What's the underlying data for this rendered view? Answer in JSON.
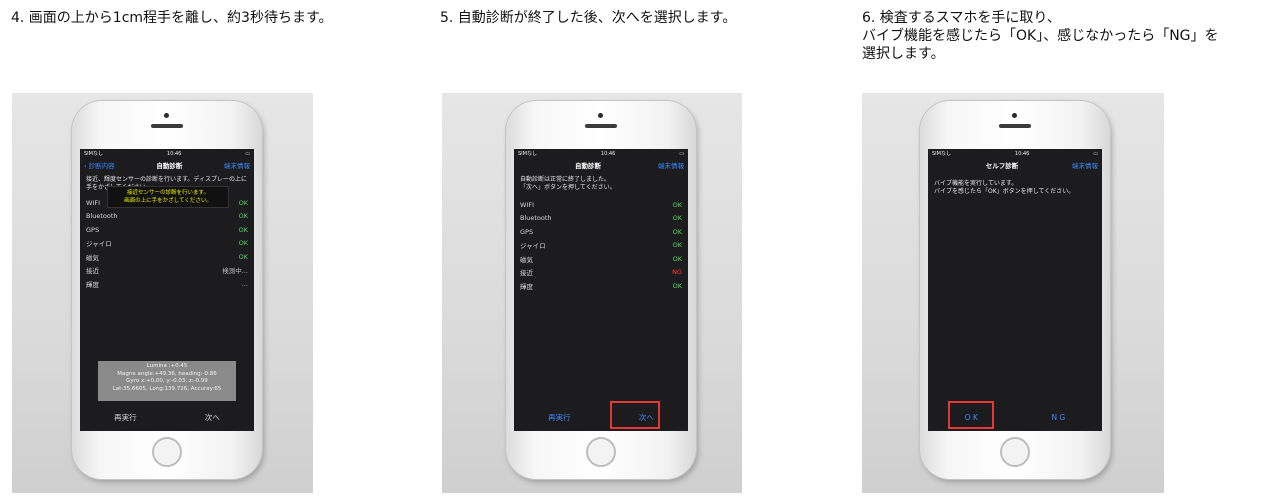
{
  "steps": [
    {
      "caption": "4. 画面の上から1cm程手を離し、約3秒待ちます。",
      "screen": {
        "status_left": "SIMなし",
        "status_time": "10:46",
        "nav_back": "診断内容",
        "nav_title": "自動診断",
        "nav_right": "端末情報",
        "message": "接近、輝度センサーの診断を行います。ディスプレーの上に手をかざしてください。",
        "toast": [
          "接近センサーの診断を行います。",
          "画面の上に手をかざしてください。"
        ],
        "rows": [
          {
            "label": "WIFI",
            "status": "OK"
          },
          {
            "label": "Bluetooth",
            "status": "OK"
          },
          {
            "label": "GPS",
            "status": "OK"
          },
          {
            "label": "ジャイロ",
            "status": "OK"
          },
          {
            "label": "磁気",
            "status": "OK"
          },
          {
            "label": "接近",
            "status": "検測中..."
          },
          {
            "label": "輝度",
            "status": "..."
          }
        ],
        "sensor_lines": [
          "Lumina :+0.45",
          "Magne angle:+49.36, heading:-0.86",
          "Gyro x:+0.00, y:-0.03, z:-0.99",
          "Lat:35.6605, Long:139.726, Accuray:65"
        ],
        "btn_left": "再実行",
        "btn_right": "次へ"
      }
    },
    {
      "caption": "5. 自動診断が終了した後、次へを選択します。",
      "screen": {
        "status_left": "SIMなし",
        "status_time": "10:46",
        "nav_back": "",
        "nav_title": "自動診断",
        "nav_right": "端末情報",
        "message": "自動診断は正常に終了しました。\n「次へ」ボタンを押してください。",
        "rows": [
          {
            "label": "WIFI",
            "status": "OK"
          },
          {
            "label": "Bluetooth",
            "status": "OK"
          },
          {
            "label": "GPS",
            "status": "OK"
          },
          {
            "label": "ジャイロ",
            "status": "OK"
          },
          {
            "label": "磁気",
            "status": "OK"
          },
          {
            "label": "接近",
            "status": "NG"
          },
          {
            "label": "輝度",
            "status": "OK"
          }
        ],
        "btn_left": "再実行",
        "btn_right": "次へ"
      }
    },
    {
      "caption": "6. 検査するスマホを手に取り、\nバイブ機能を感じたら「OK」、感じなかったら「NG」を\n選択します。",
      "screen": {
        "status_left": "SIMなし",
        "status_time": "10:46",
        "nav_back": "",
        "nav_title": "セルフ診断",
        "nav_right": "端末情報",
        "message": "バイブ機能を実行しています。\nバイブを感じたら「OK」ボタンを押してください。",
        "btn_left": "O K",
        "btn_right": "N G"
      }
    }
  ],
  "colors": {
    "highlight": "#e53935",
    "ios_blue": "#3d8bff",
    "ok_green": "#4cd964",
    "ng_red": "#ff3b30"
  }
}
